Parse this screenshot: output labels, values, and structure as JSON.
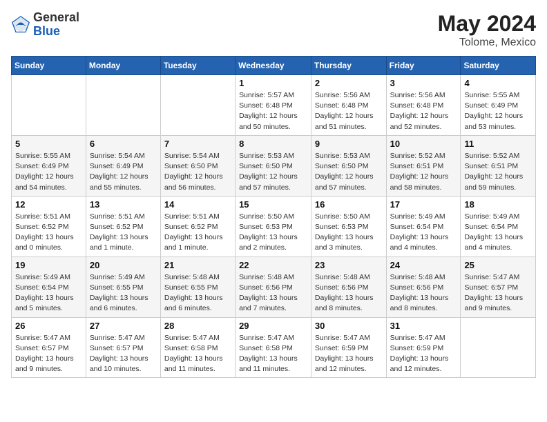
{
  "header": {
    "logo_general": "General",
    "logo_blue": "Blue",
    "month_year": "May 2024",
    "location": "Tolome, Mexico"
  },
  "weekdays": [
    "Sunday",
    "Monday",
    "Tuesday",
    "Wednesday",
    "Thursday",
    "Friday",
    "Saturday"
  ],
  "weeks": [
    [
      {
        "day": "",
        "info": ""
      },
      {
        "day": "",
        "info": ""
      },
      {
        "day": "",
        "info": ""
      },
      {
        "day": "1",
        "info": "Sunrise: 5:57 AM\nSunset: 6:48 PM\nDaylight: 12 hours\nand 50 minutes."
      },
      {
        "day": "2",
        "info": "Sunrise: 5:56 AM\nSunset: 6:48 PM\nDaylight: 12 hours\nand 51 minutes."
      },
      {
        "day": "3",
        "info": "Sunrise: 5:56 AM\nSunset: 6:48 PM\nDaylight: 12 hours\nand 52 minutes."
      },
      {
        "day": "4",
        "info": "Sunrise: 5:55 AM\nSunset: 6:49 PM\nDaylight: 12 hours\nand 53 minutes."
      }
    ],
    [
      {
        "day": "5",
        "info": "Sunrise: 5:55 AM\nSunset: 6:49 PM\nDaylight: 12 hours\nand 54 minutes."
      },
      {
        "day": "6",
        "info": "Sunrise: 5:54 AM\nSunset: 6:49 PM\nDaylight: 12 hours\nand 55 minutes."
      },
      {
        "day": "7",
        "info": "Sunrise: 5:54 AM\nSunset: 6:50 PM\nDaylight: 12 hours\nand 56 minutes."
      },
      {
        "day": "8",
        "info": "Sunrise: 5:53 AM\nSunset: 6:50 PM\nDaylight: 12 hours\nand 57 minutes."
      },
      {
        "day": "9",
        "info": "Sunrise: 5:53 AM\nSunset: 6:50 PM\nDaylight: 12 hours\nand 57 minutes."
      },
      {
        "day": "10",
        "info": "Sunrise: 5:52 AM\nSunset: 6:51 PM\nDaylight: 12 hours\nand 58 minutes."
      },
      {
        "day": "11",
        "info": "Sunrise: 5:52 AM\nSunset: 6:51 PM\nDaylight: 12 hours\nand 59 minutes."
      }
    ],
    [
      {
        "day": "12",
        "info": "Sunrise: 5:51 AM\nSunset: 6:52 PM\nDaylight: 13 hours\nand 0 minutes."
      },
      {
        "day": "13",
        "info": "Sunrise: 5:51 AM\nSunset: 6:52 PM\nDaylight: 13 hours\nand 1 minute."
      },
      {
        "day": "14",
        "info": "Sunrise: 5:51 AM\nSunset: 6:52 PM\nDaylight: 13 hours\nand 1 minute."
      },
      {
        "day": "15",
        "info": "Sunrise: 5:50 AM\nSunset: 6:53 PM\nDaylight: 13 hours\nand 2 minutes."
      },
      {
        "day": "16",
        "info": "Sunrise: 5:50 AM\nSunset: 6:53 PM\nDaylight: 13 hours\nand 3 minutes."
      },
      {
        "day": "17",
        "info": "Sunrise: 5:49 AM\nSunset: 6:54 PM\nDaylight: 13 hours\nand 4 minutes."
      },
      {
        "day": "18",
        "info": "Sunrise: 5:49 AM\nSunset: 6:54 PM\nDaylight: 13 hours\nand 4 minutes."
      }
    ],
    [
      {
        "day": "19",
        "info": "Sunrise: 5:49 AM\nSunset: 6:54 PM\nDaylight: 13 hours\nand 5 minutes."
      },
      {
        "day": "20",
        "info": "Sunrise: 5:49 AM\nSunset: 6:55 PM\nDaylight: 13 hours\nand 6 minutes."
      },
      {
        "day": "21",
        "info": "Sunrise: 5:48 AM\nSunset: 6:55 PM\nDaylight: 13 hours\nand 6 minutes."
      },
      {
        "day": "22",
        "info": "Sunrise: 5:48 AM\nSunset: 6:56 PM\nDaylight: 13 hours\nand 7 minutes."
      },
      {
        "day": "23",
        "info": "Sunrise: 5:48 AM\nSunset: 6:56 PM\nDaylight: 13 hours\nand 8 minutes."
      },
      {
        "day": "24",
        "info": "Sunrise: 5:48 AM\nSunset: 6:56 PM\nDaylight: 13 hours\nand 8 minutes."
      },
      {
        "day": "25",
        "info": "Sunrise: 5:47 AM\nSunset: 6:57 PM\nDaylight: 13 hours\nand 9 minutes."
      }
    ],
    [
      {
        "day": "26",
        "info": "Sunrise: 5:47 AM\nSunset: 6:57 PM\nDaylight: 13 hours\nand 9 minutes."
      },
      {
        "day": "27",
        "info": "Sunrise: 5:47 AM\nSunset: 6:57 PM\nDaylight: 13 hours\nand 10 minutes."
      },
      {
        "day": "28",
        "info": "Sunrise: 5:47 AM\nSunset: 6:58 PM\nDaylight: 13 hours\nand 11 minutes."
      },
      {
        "day": "29",
        "info": "Sunrise: 5:47 AM\nSunset: 6:58 PM\nDaylight: 13 hours\nand 11 minutes."
      },
      {
        "day": "30",
        "info": "Sunrise: 5:47 AM\nSunset: 6:59 PM\nDaylight: 13 hours\nand 12 minutes."
      },
      {
        "day": "31",
        "info": "Sunrise: 5:47 AM\nSunset: 6:59 PM\nDaylight: 13 hours\nand 12 minutes."
      },
      {
        "day": "",
        "info": ""
      }
    ]
  ]
}
